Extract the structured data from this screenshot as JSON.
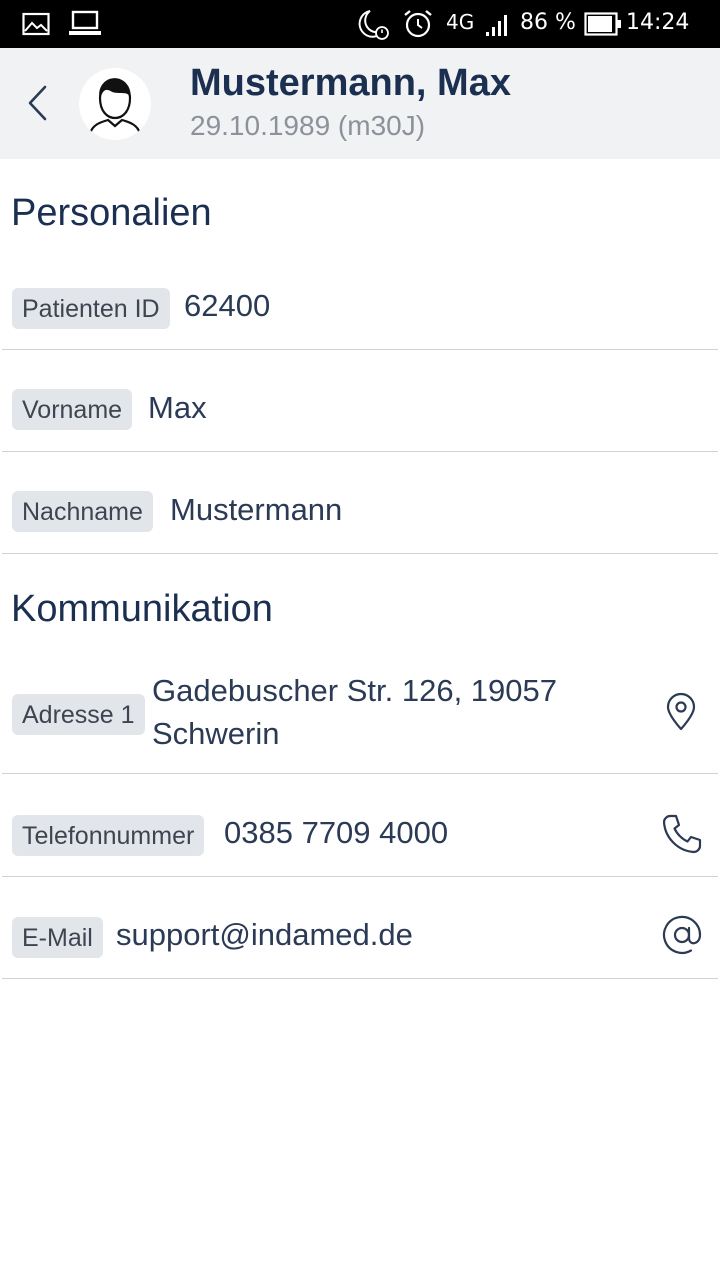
{
  "status_bar": {
    "network": "4G",
    "battery_percent": "86 %",
    "time": "14:24",
    "icons": [
      "image-icon",
      "laptop-icon",
      "night-alarm-icon",
      "alarm-clock-icon",
      "signal-icon",
      "battery-icon"
    ]
  },
  "header": {
    "back_icon": "chevron-left-icon",
    "avatar_icon": "person-avatar-icon",
    "name": "Mustermann, Max",
    "dob": "29.10.1989 (m30J)"
  },
  "personalien": {
    "title": "Personalien",
    "fields": [
      {
        "label": "Patienten ID",
        "value": "62400"
      },
      {
        "label": "Vorname",
        "value": "Max"
      },
      {
        "label": "Nachname",
        "value": "Mustermann"
      }
    ]
  },
  "kommunikation": {
    "title": "Kommunikation",
    "fields": [
      {
        "label": "Adresse 1",
        "value_line1": "Gadebuscher Str. 126, 19057",
        "value_line2": "Schwerin",
        "icon": "map-pin-icon"
      },
      {
        "label": "Telefonnummer",
        "value": "0385 7709 4000",
        "icon": "phone-icon"
      },
      {
        "label": "E-Mail",
        "value": "support@indamed.de",
        "icon": "at-sign-icon"
      }
    ]
  },
  "colors": {
    "header_bg": "#f1f2f4",
    "title_color": "#1b2f50",
    "tag_bg": "#e2e5ea",
    "divider": "#cfd2d6"
  }
}
